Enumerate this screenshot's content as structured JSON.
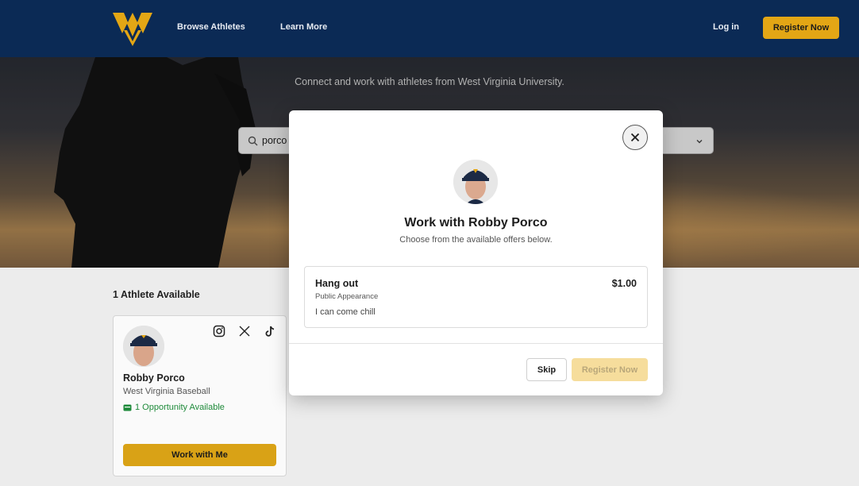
{
  "header": {
    "nav": [
      "Browse Athletes",
      "Learn More"
    ],
    "login_label": "Log in",
    "register_label": "Register Now"
  },
  "hero": {
    "tagline": "Connect and work with athletes from West Virginia University.",
    "search": {
      "value": "porco"
    }
  },
  "results": {
    "count_label": "1 Athlete Available",
    "cards": [
      {
        "name": "Robby Porco",
        "team": "West Virginia Baseball",
        "opportunities": "1 Opportunity Available",
        "button_label": "Work with Me",
        "socials": [
          "instagram-icon",
          "x-icon",
          "tiktok-icon"
        ]
      }
    ]
  },
  "modal": {
    "title": "Work with Robby Porco",
    "subtitle": "Choose from the available offers below.",
    "offers": [
      {
        "title": "Hang out",
        "type": "Public Appearance",
        "description": "I can come chill",
        "price": "$1.00"
      }
    ],
    "skip_label": "Skip",
    "register_label": "Register Now"
  },
  "colors": {
    "navy": "#0b2a55",
    "gold": "#e3a615",
    "gold_disabled": "#f6dd9c",
    "opportunity_green": "#1e8a3a"
  }
}
